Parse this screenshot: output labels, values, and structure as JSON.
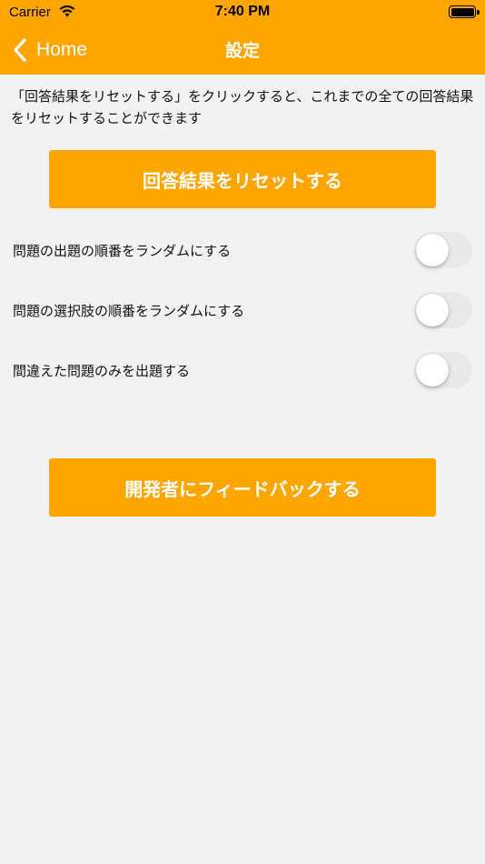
{
  "status_bar": {
    "carrier": "Carrier",
    "time": "7:40 PM"
  },
  "nav": {
    "back_label": "Home",
    "title": "設定"
  },
  "main": {
    "description": "「回答結果をリセットする」をクリックすると、これまでの全ての回答結果をリセットすることができます",
    "reset_button": "回答結果をリセットする",
    "settings": [
      {
        "label": "問題の出題の順番をランダムにする",
        "enabled": false
      },
      {
        "label": "問題の選択肢の順番をランダムにする",
        "enabled": false
      },
      {
        "label": "間違えた問題のみを出題する",
        "enabled": false
      }
    ],
    "feedback_button": "開発者にフィードバックする"
  },
  "colors": {
    "accent": "#ffa500",
    "background": "#f2f2f2",
    "toggle_off": "#e9e9ea"
  }
}
